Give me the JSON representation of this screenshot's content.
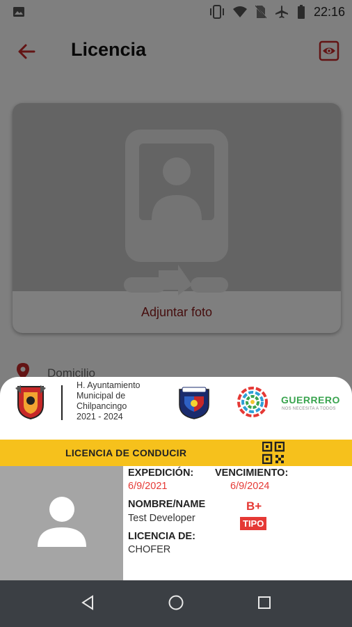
{
  "status_bar": {
    "time": "22:16",
    "icons": [
      "image-icon",
      "vibrate-icon",
      "wifi-icon",
      "no-sim-icon",
      "airplane-icon",
      "battery-icon"
    ]
  },
  "app_bar": {
    "title": "Licencia",
    "back_icon": "arrow-back-icon",
    "action_icon": "eye-icon",
    "accent_color": "#b71c1c"
  },
  "photo_card": {
    "attach_label": "Adjuntar foto",
    "placeholder_icon": "portrait-swap-icon"
  },
  "address": {
    "label": "Domicilio",
    "icon": "location-pin-icon"
  },
  "license": {
    "ayuntamiento": {
      "line1": "H. Ayuntamiento",
      "line2": "Municipal de",
      "line3": "Chilpancingo",
      "line4": "2021 - 2024"
    },
    "guerrero": {
      "name": "GUERRERO",
      "tagline": "NOS NECESITA A TODOS"
    },
    "banner_title": "LICENCIA DE CONDUCIR",
    "banner_color": "#f6c11c",
    "expedicion_label": "EXPEDICIÓN:",
    "expedicion_value": "6/9/2021",
    "vencimiento_label": "VENCIMIENTO:",
    "vencimiento_value": "6/9/2024",
    "name_label": "NOMBRE/NAME",
    "name_value": "Test Developer",
    "tipo_value": "B+",
    "tipo_label": "TIPO",
    "licencia_label": "LICENCIA DE:",
    "licencia_value": "CHOFER"
  },
  "nav_bar": {
    "back": "nav-back-icon",
    "home": "nav-home-icon",
    "recents": "nav-recents-icon"
  }
}
